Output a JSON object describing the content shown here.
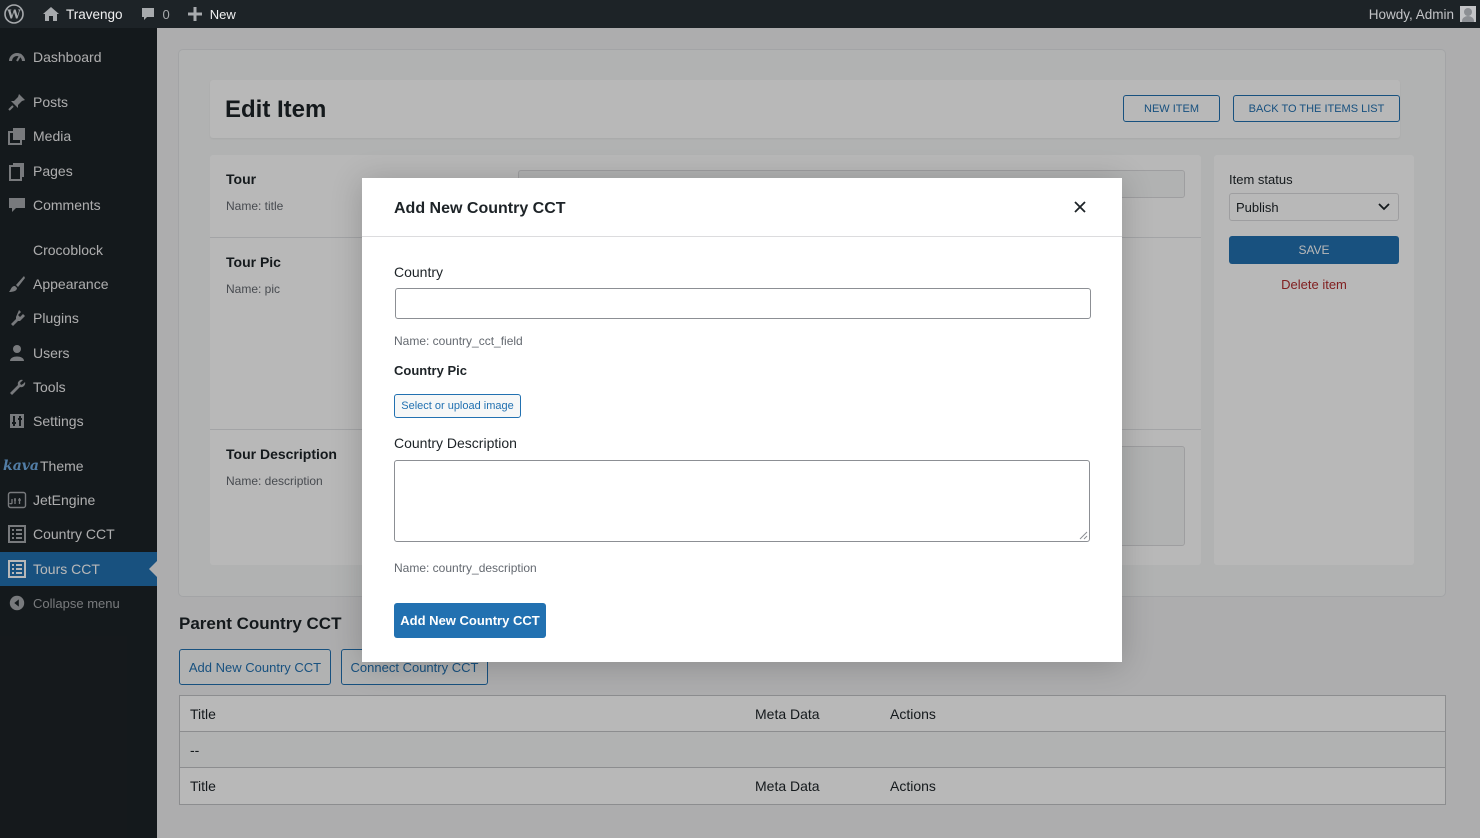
{
  "adminbar": {
    "site_name": "Travengo",
    "comments_count": "0",
    "new_label": "New",
    "howdy": "Howdy, Admin"
  },
  "sidebar": {
    "items": [
      {
        "label": "Dashboard",
        "icon": "dashboard-icon"
      },
      {
        "label": "Posts",
        "icon": "pin-icon"
      },
      {
        "label": "Media",
        "icon": "media-icon"
      },
      {
        "label": "Pages",
        "icon": "pages-icon"
      },
      {
        "label": "Comments",
        "icon": "comment-icon"
      },
      {
        "label": "Crocoblock",
        "icon": "crocoblock-icon"
      },
      {
        "label": "Appearance",
        "icon": "brush-icon"
      },
      {
        "label": "Plugins",
        "icon": "plugin-icon"
      },
      {
        "label": "Users",
        "icon": "user-icon"
      },
      {
        "label": "Tools",
        "icon": "wrench-icon"
      },
      {
        "label": "Settings",
        "icon": "settings-icon"
      },
      {
        "label": "Theme",
        "icon": "kava-logo",
        "logo_text": "kava"
      },
      {
        "label": "JetEngine",
        "icon": "jetengine-icon"
      },
      {
        "label": "Country CCT",
        "icon": "list-icon"
      },
      {
        "label": "Tours CCT",
        "icon": "list-icon",
        "current": true
      },
      {
        "label": "Collapse menu",
        "icon": "collapse-icon"
      }
    ]
  },
  "editor": {
    "title": "Edit Item",
    "new_item": "NEW ITEM",
    "back_to_list": "BACK TO THE ITEMS LIST",
    "fields": [
      {
        "label": "Tour",
        "name": "Name: title"
      },
      {
        "label": "Tour Pic",
        "name": "Name: pic"
      },
      {
        "label": "Tour Description",
        "name": "Name: description"
      }
    ],
    "status_label": "Item status",
    "status_value": "Publish",
    "save": "SAVE",
    "delete": "Delete item"
  },
  "relation": {
    "title": "Parent Country CCT",
    "add_new": "Add New Country CCT",
    "connect": "Connect Country CCT",
    "columns": [
      "Title",
      "Meta Data",
      "Actions"
    ],
    "empty_row": "--"
  },
  "modal": {
    "title": "Add New Country CCT",
    "country_label": "Country",
    "country_value": "",
    "country_name": "Name: country_cct_field",
    "pic_label": "Country Pic",
    "upload_label": "Select or upload image",
    "description_label": "Country Description",
    "description_value": "",
    "description_name": "Name: country_description",
    "submit": "Add New Country CCT"
  },
  "colors": {
    "adminbar": "#1d2327",
    "accent": "#2271b1",
    "danger": "#b32d2e",
    "background": "#f0f0f1"
  }
}
